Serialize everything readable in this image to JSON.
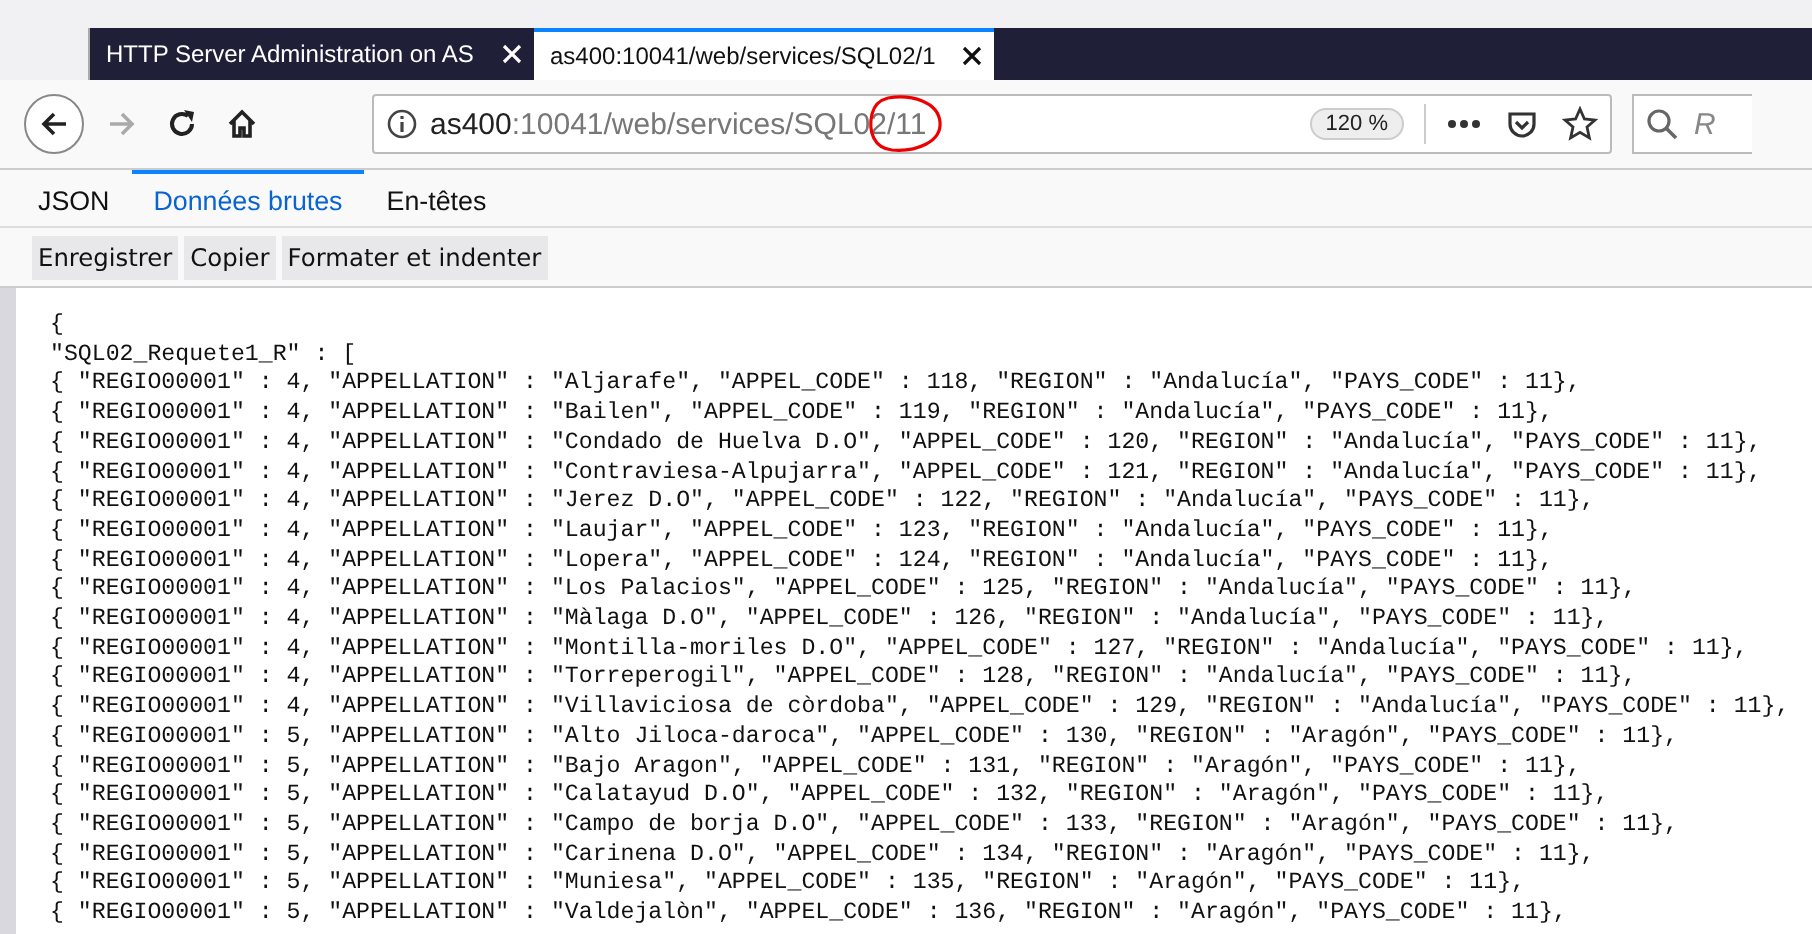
{
  "browser_tabs": [
    {
      "title": "HTTP Server Administration on AS",
      "selected": false
    },
    {
      "title": "as400:10041/web/services/SQL02/1",
      "selected": true
    }
  ],
  "address_bar": {
    "host": "as400",
    "path": ":10041/web/services/SQL02/11",
    "zoom": "120 %",
    "annotation_circled": true
  },
  "search": {
    "placeholder": "R"
  },
  "viewer_tabs": [
    {
      "label": "JSON",
      "selected": false
    },
    {
      "label": "Données brutes",
      "selected": true
    },
    {
      "label": "En-têtes",
      "selected": false
    }
  ],
  "toolbar_buttons": [
    "Enregistrer",
    "Copier",
    "Formater et indenter"
  ],
  "raw_lines": [
    "{",
    "\"SQL02_Requete1_R\" : [",
    "{ \"REGIO00001\" : 4, \"APPELLATION\" : \"Aljarafe\", \"APPEL_CODE\" : 118, \"REGION\" : \"Andalucía\", \"PAYS_CODE\" : 11},",
    "{ \"REGIO00001\" : 4, \"APPELLATION\" : \"Bailen\", \"APPEL_CODE\" : 119, \"REGION\" : \"Andalucía\", \"PAYS_CODE\" : 11},",
    "{ \"REGIO00001\" : 4, \"APPELLATION\" : \"Condado de Huelva D.O\", \"APPEL_CODE\" : 120, \"REGION\" : \"Andalucía\", \"PAYS_CODE\" : 11},",
    "{ \"REGIO00001\" : 4, \"APPELLATION\" : \"Contraviesa-Alpujarra\", \"APPEL_CODE\" : 121, \"REGION\" : \"Andalucía\", \"PAYS_CODE\" : 11},",
    "{ \"REGIO00001\" : 4, \"APPELLATION\" : \"Jerez D.O\", \"APPEL_CODE\" : 122, \"REGION\" : \"Andalucía\", \"PAYS_CODE\" : 11},",
    "{ \"REGIO00001\" : 4, \"APPELLATION\" : \"Laujar\", \"APPEL_CODE\" : 123, \"REGION\" : \"Andalucía\", \"PAYS_CODE\" : 11},",
    "{ \"REGIO00001\" : 4, \"APPELLATION\" : \"Lopera\", \"APPEL_CODE\" : 124, \"REGION\" : \"Andalucía\", \"PAYS_CODE\" : 11},",
    "{ \"REGIO00001\" : 4, \"APPELLATION\" : \"Los Palacios\", \"APPEL_CODE\" : 125, \"REGION\" : \"Andalucía\", \"PAYS_CODE\" : 11},",
    "{ \"REGIO00001\" : 4, \"APPELLATION\" : \"Màlaga D.O\", \"APPEL_CODE\" : 126, \"REGION\" : \"Andalucía\", \"PAYS_CODE\" : 11},",
    "{ \"REGIO00001\" : 4, \"APPELLATION\" : \"Montilla-moriles D.O\", \"APPEL_CODE\" : 127, \"REGION\" : \"Andalucía\", \"PAYS_CODE\" : 11},",
    "{ \"REGIO00001\" : 4, \"APPELLATION\" : \"Torreperogil\", \"APPEL_CODE\" : 128, \"REGION\" : \"Andalucía\", \"PAYS_CODE\" : 11},",
    "{ \"REGIO00001\" : 4, \"APPELLATION\" : \"Villaviciosa de còrdoba\", \"APPEL_CODE\" : 129, \"REGION\" : \"Andalucía\", \"PAYS_CODE\" : 11},",
    "{ \"REGIO00001\" : 5, \"APPELLATION\" : \"Alto Jiloca-daroca\", \"APPEL_CODE\" : 130, \"REGION\" : \"Aragón\", \"PAYS_CODE\" : 11},",
    "{ \"REGIO00001\" : 5, \"APPELLATION\" : \"Bajo Aragon\", \"APPEL_CODE\" : 131, \"REGION\" : \"Aragón\", \"PAYS_CODE\" : 11},",
    "{ \"REGIO00001\" : 5, \"APPELLATION\" : \"Calatayud D.O\", \"APPEL_CODE\" : 132, \"REGION\" : \"Aragón\", \"PAYS_CODE\" : 11},",
    "{ \"REGIO00001\" : 5, \"APPELLATION\" : \"Campo de borja D.O\", \"APPEL_CODE\" : 133, \"REGION\" : \"Aragón\", \"PAYS_CODE\" : 11},",
    "{ \"REGIO00001\" : 5, \"APPELLATION\" : \"Carinena D.O\", \"APPEL_CODE\" : 134, \"REGION\" : \"Aragón\", \"PAYS_CODE\" : 11},",
    "{ \"REGIO00001\" : 5, \"APPELLATION\" : \"Muniesa\", \"APPEL_CODE\" : 135, \"REGION\" : \"Aragón\", \"PAYS_CODE\" : 11},",
    "{ \"REGIO00001\" : 5, \"APPELLATION\" : \"Valdejalòn\", \"APPEL_CODE\" : 136, \"REGION\" : \"Aragón\", \"PAYS_CODE\" : 11},"
  ]
}
